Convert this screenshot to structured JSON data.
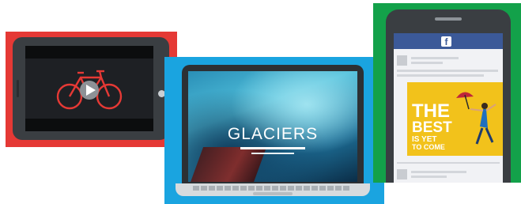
{
  "panels": {
    "tablet": {
      "background": "#e53935",
      "icon": "bicycle-play-icon",
      "accent": "#e53935"
    },
    "laptop": {
      "background": "#1aa4e0",
      "screen_title": "GLACIERS"
    },
    "phone": {
      "background": "#13a14a",
      "feed_logo": "f",
      "post_quote": [
        "THE",
        "BEST",
        "IS YET",
        "TO COME"
      ],
      "post_background": "#f2c21b"
    }
  }
}
